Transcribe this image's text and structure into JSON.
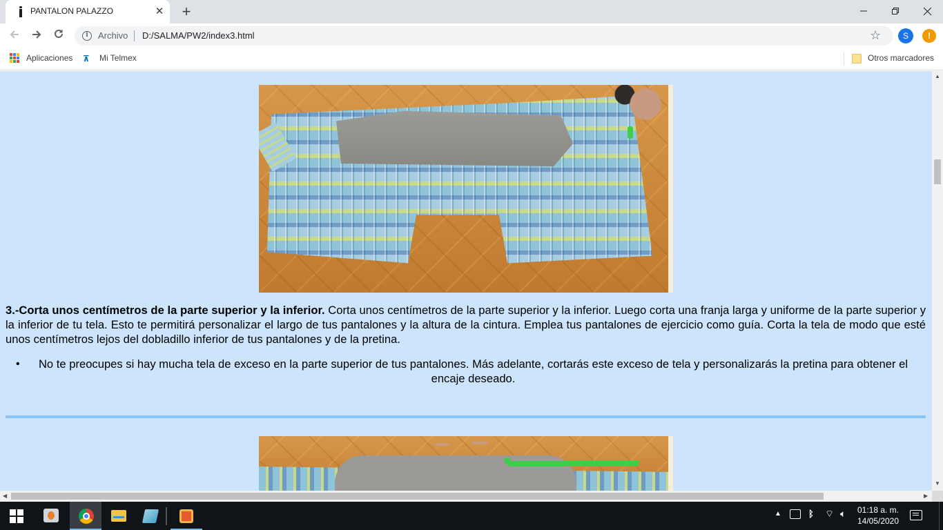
{
  "browser": {
    "tab_title": "PANTALON PALAZZO",
    "new_tab_symbol": "+",
    "close_tab_symbol": "✕",
    "omnibox": {
      "scheme_label": "Archivo",
      "url": "D:/SALMA/PW2/index3.html"
    },
    "profile_initial": "S",
    "update_badge": "!"
  },
  "bookmarks": {
    "apps_label": "Aplicaciones",
    "telmex_label": "Mi Telmex",
    "other_label": "Otros marcadores"
  },
  "page": {
    "step": {
      "heading": "3.-Corta unos centímetros de la parte superior y la inferior.",
      "body": " Corta unos centímetros de la parte superior y la inferior. Luego corta una franja larga y uniforme de la parte superior y la inferior de tu tela. Esto te permitirá personalizar el largo de tus pantalones y la altura de la cintura. Emplea tus pantalones de ejercicio como guía. Corta la tela de modo que esté unos centímetros lejos del dobladillo inferior de tus pantalones y de la pretina."
    },
    "tips": [
      "No te preocupes si hay mucha tela de exceso en la parte superior de tus pantalones. Más adelante, cortarás este exceso de tela y personalizarás la pretina para obtener el encaje deseado."
    ]
  },
  "taskbar": {
    "time": "01:18 a. m.",
    "date": "14/05/2020"
  },
  "icons": {
    "back": "arrow-left-icon",
    "forward": "arrow-right-icon",
    "reload": "reload-icon",
    "info": "info-icon",
    "star": "star-icon",
    "apps": "apps-grid-icon",
    "folder": "folder-icon"
  },
  "colors": {
    "page_background": "#cce5fc",
    "rule": "#87c4f2",
    "taskbar": "#101418",
    "tab_strip": "#dee1e6"
  }
}
